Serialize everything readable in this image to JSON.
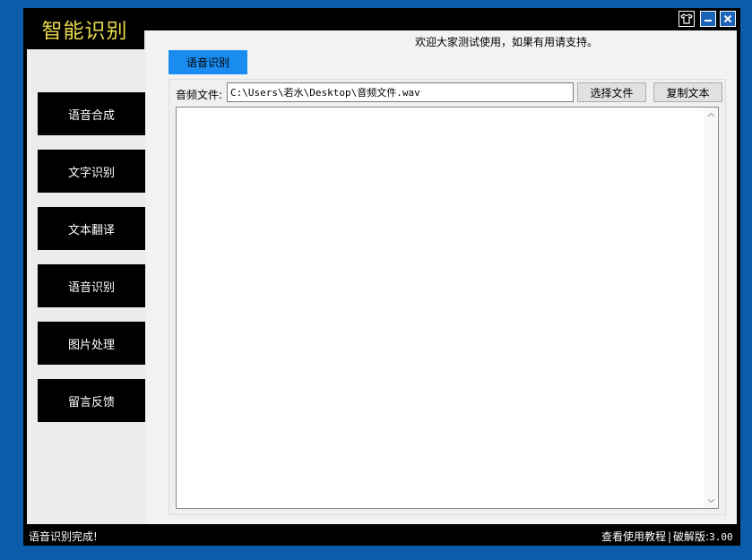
{
  "app": {
    "logo_title": "智能识别",
    "skin_icon": "shirt-icon",
    "minimize_icon": "minimize-icon",
    "close_icon": "close-icon"
  },
  "header": {
    "welcome": "欢迎大家测试使用，如果有用请支持。"
  },
  "sidebar": {
    "items": [
      {
        "label": "语音合成"
      },
      {
        "label": "文字识别"
      },
      {
        "label": "文本翻译"
      },
      {
        "label": "语音识别"
      },
      {
        "label": "图片处理"
      },
      {
        "label": "留言反馈"
      }
    ]
  },
  "main": {
    "active_tab": "语音识别",
    "file_label": "音频文件:",
    "file_path": "C:\\Users\\若水\\Desktop\\音频文件.wav",
    "select_button": "选择文件",
    "copy_button": "复制文本",
    "result_text": ""
  },
  "status": {
    "message": "语音识别完成!",
    "tutorial_link": "查看使用教程",
    "separator": "|",
    "version_label": "破解版:",
    "version": "3.00"
  },
  "colors": {
    "desktop": "#0b5cab",
    "logo_text": "#e8d84a",
    "tab_accent": "#1a8cf0",
    "window_button": "#1b63b8"
  }
}
